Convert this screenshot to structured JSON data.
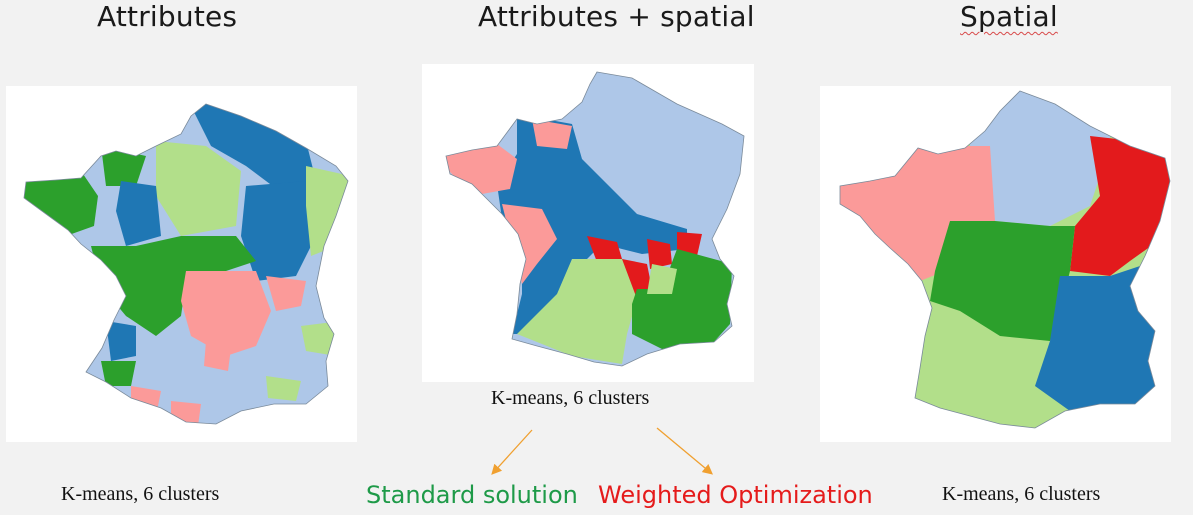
{
  "titles": {
    "attributes": "Attributes",
    "both": "Attributes + spatial",
    "spatial": "Spatial"
  },
  "captions": {
    "left": "K-means, 6 clusters",
    "middle": "K-means, 6 clusters",
    "right": "K-means, 6 clusters"
  },
  "options": {
    "standard": "Standard solution",
    "weighted": "Weighted Optimization"
  },
  "colors": {
    "dark_blue": "#1f77b4",
    "light_blue": "#aec7e8",
    "dark_green": "#2ca02c",
    "light_green": "#b2df8a",
    "red": "#e31a1c",
    "pink": "#fb9a99",
    "standard_text": "#1e9a48",
    "weighted_text": "#e51b1b",
    "arrow": "#f0a030"
  },
  "maps": [
    {
      "name": "attributes-map",
      "clusters": [
        "dark_blue",
        "light_blue",
        "dark_green",
        "light_green",
        "pink"
      ]
    },
    {
      "name": "attributes-spatial-map",
      "clusters": [
        "light_blue",
        "dark_blue",
        "pink",
        "red",
        "light_green",
        "dark_green"
      ]
    },
    {
      "name": "spatial-map",
      "clusters": [
        "pink",
        "light_blue",
        "red",
        "dark_green",
        "light_green",
        "dark_blue"
      ]
    }
  ]
}
